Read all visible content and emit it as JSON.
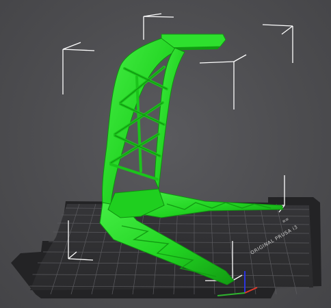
{
  "viewport": {
    "bed_label": "ORIGINAL PRUSA i3",
    "model_color": "#22dd22",
    "model_shadow_color": "#12a012",
    "bed_color": "#2b2b2d",
    "grid_color": "#6b6b6e",
    "bounding_box_color": "#ffffff"
  }
}
